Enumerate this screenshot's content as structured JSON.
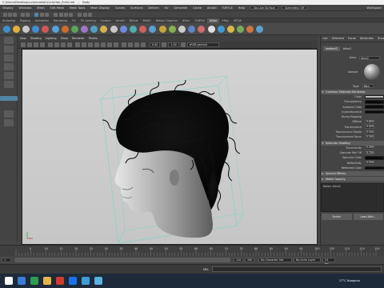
{
  "window": {
    "title": "C:\\Users\\Desktop\\curlyhairAsk\\CurlyHair_Ernie.mb",
    "object": "Body"
  },
  "menubar": {
    "items": [
      "Display",
      "Windows",
      "Mesh",
      "Edit Mesh",
      "Mesh Tools",
      "Mesh Display",
      "Curves",
      "Surfaces",
      "Deform",
      "UV",
      "Generate",
      "Cache",
      "Arnold",
      "TURTLE",
      "Help"
    ],
    "no_live_surface": "No Live Surface",
    "symmetry": "Symmetry: Off",
    "workspace": "Workspace"
  },
  "shelf": {
    "tabs": [
      "Sculpting",
      "Rigging",
      "Animation",
      "Rendering",
      "FX",
      "FX Caching",
      "Custom",
      "Arnold",
      "Bifrost",
      "MASH",
      "Motion Graphics",
      "XGen",
      "TURTLE",
      "XGen",
      "VRay",
      "MTOA"
    ],
    "active_tab_index": 13,
    "icon_colors": [
      "#3d8fd1",
      "#e0b13a",
      "#c9c9c9",
      "#3d8fd1",
      "#d45757",
      "#54a3d6",
      "#cf6c2c",
      "#5aa35a",
      "#9c77c9",
      "#4fa1c9",
      "#d4b34a",
      "#c9c9c9",
      "#6e8bd8",
      "#4ab0b0",
      "#d06060",
      "#5c9fd0",
      "#c9a43b",
      "#82b34b",
      "#cccccc",
      "#5e84c8",
      "#d46a6a",
      "#e0e0e0",
      "#3f9bd6",
      "#d7b84a",
      "#79aa5c",
      "#cc7744",
      "#5aa0cf"
    ]
  },
  "viewport": {
    "panel_menu": [
      "View",
      "Shading",
      "Lighting",
      "Show",
      "Renderer",
      "Panels"
    ],
    "field_values": [
      "0.00",
      "1.00"
    ],
    "color_space": "sRGB gamma"
  },
  "attribute_editor": {
    "tabs": [
      "List",
      "Selected",
      "Focus",
      "Attributes",
      "Show",
      "Help"
    ],
    "node_label": "lambert2",
    "node_value": "blinn2",
    "sample_label": "Sample",
    "type_label": "Type",
    "type_value": "Blinn",
    "sections": {
      "common": "Common Material Attributes",
      "specular": "Specular Shading",
      "special": "Special Effects",
      "matte": "Matte Opacity"
    },
    "common_attrs": [
      {
        "label": "Color",
        "kind": "swatch-light"
      },
      {
        "label": "Transparency",
        "kind": "swatch"
      },
      {
        "label": "Ambient Color",
        "kind": "swatch"
      },
      {
        "label": "Incandescence",
        "kind": "swatch"
      },
      {
        "label": "Bump Mapping",
        "kind": "none"
      },
      {
        "label": "Diffuse",
        "kind": "value",
        "value": "0.800"
      },
      {
        "label": "Translucence",
        "kind": "value",
        "value": "0.000"
      },
      {
        "label": "Translucence Depth",
        "kind": "value",
        "value": "0.500"
      },
      {
        "label": "Translucence Focus",
        "kind": "value",
        "value": "0.500"
      }
    ],
    "specular_attrs": [
      {
        "label": "Eccentricity",
        "value": "0.300"
      },
      {
        "label": "Specular Roll Off",
        "value": "0.700"
      },
      {
        "label": "Specular Color",
        "kind": "swatch"
      },
      {
        "label": "Reflectivity",
        "value": "0.500"
      },
      {
        "label": "Reflected Color",
        "kind": "swatch"
      }
    ],
    "notes_label": "Notes: blinn2",
    "buttons": {
      "select": "Select",
      "load": "Load Attri..."
    }
  },
  "timeline": {
    "ticks": [
      "5",
      "10",
      "15",
      "20",
      "25",
      "30",
      "35",
      "40",
      "45",
      "50",
      "55",
      "60",
      "65",
      "70",
      "75",
      "80",
      "85",
      "90",
      "95",
      "100",
      "105",
      "110",
      "115",
      "120"
    ],
    "range_start": "1",
    "range_end": "120",
    "anim_end": "200",
    "char_set": "No Character Set",
    "anim_layer": "No Anim Layer",
    "fps": "24 fps",
    "cmd_lang": "MEL"
  },
  "taskbar": {
    "weather": "17°C  Nuageux",
    "icon_colors": [
      "#ffffff",
      "#3a7bd5",
      "#2d9e4f",
      "#e8b44a",
      "#d03a2c",
      "#1a73e8",
      "#3c9dd9",
      "#5ab2e0"
    ]
  },
  "colors": {
    "accent": "#5285a6",
    "bounding_box": "#59d9c6"
  }
}
